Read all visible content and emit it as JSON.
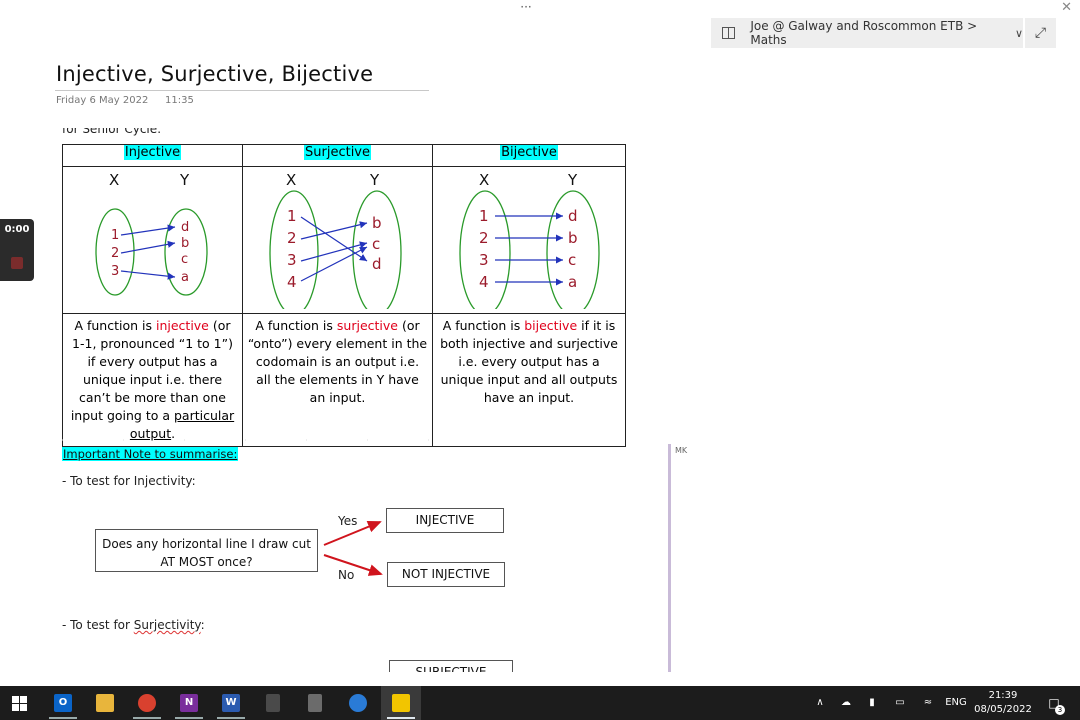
{
  "window": {
    "more_label": "···",
    "close_label": "✕"
  },
  "breadcrumb": {
    "text": "Joe @ Galway and Roscommon ETB > Maths",
    "expand_label": "⤢"
  },
  "page": {
    "title": "Injective, Surjective, Bijective",
    "date": "Friday 6 May 2022",
    "time": "11:35"
  },
  "cut_text": "for Senior Cycle:",
  "table": {
    "headers": [
      "Injective",
      "Surjective",
      "Bijective"
    ],
    "x_label": "X",
    "y_label": "Y",
    "injective": {
      "domain": [
        "1",
        "2",
        "3"
      ],
      "codomain": [
        "d",
        "b",
        "c",
        "a"
      ],
      "desc_pre": "A function is ",
      "desc_term": "injective",
      "desc_post": " (or 1-1, pronounced “1 to 1”) if every output has a unique input i.e. there can’t be more than one input going to a ",
      "desc_ul": "particular output",
      "desc_end": "."
    },
    "surjective": {
      "domain": [
        "1",
        "2",
        "3",
        "4"
      ],
      "codomain": [
        "b",
        "c",
        "d"
      ],
      "desc_pre": "A function is ",
      "desc_term": "surjective",
      "desc_post": " (or “onto”) every element in the codomain is an output i.e.  all the elements in Y have an input."
    },
    "bijective": {
      "domain": [
        "1",
        "2",
        "3",
        "4"
      ],
      "codomain": [
        "d",
        "b",
        "c",
        "a"
      ],
      "desc_pre": "A function is ",
      "desc_term": "bijective",
      "desc_post": " if it is both injective and surjective i.e. every output has a unique input and all outputs have an input."
    }
  },
  "notes": {
    "heading": "Important Note to summarise:",
    "bullet1_pre": "-    To test for Injectivity:",
    "bullet2_pre": "-    To test for ",
    "bullet2_term": "Surjectivity",
    "bullet2_end": ":",
    "question": "Does any horizontal line I draw cut AT MOST once?",
    "yes": "Yes",
    "no": "No",
    "injective_box": "INJECTIVE",
    "not_injective_box": "NOT INJECTIVE",
    "surjective_box": "SURJECTIVE"
  },
  "margin_tag": "MK",
  "recorder": {
    "time": "0:00"
  },
  "taskbar": {
    "apps": [
      {
        "name": "outlook",
        "letter": "O",
        "color": "#0a64c8"
      },
      {
        "name": "explorer",
        "letter": "",
        "color": "#e8b53c"
      },
      {
        "name": "chrome",
        "letter": "",
        "color": "#d9412f"
      },
      {
        "name": "onenote",
        "letter": "N",
        "color": "#7a2e9c"
      },
      {
        "name": "word",
        "letter": "W",
        "color": "#2b5bb0"
      },
      {
        "name": "calculator-dark",
        "letter": "",
        "color": "#4a4a4a"
      },
      {
        "name": "calculator",
        "letter": "",
        "color": "#6b6b6b"
      },
      {
        "name": "settings",
        "letter": "",
        "color": "#2a7bd6"
      },
      {
        "name": "sticky-notes",
        "letter": "",
        "color": "#f2c500"
      }
    ],
    "language": "ENG",
    "clock_time": "21:39",
    "clock_date": "08/05/2022",
    "notifications": "3"
  }
}
